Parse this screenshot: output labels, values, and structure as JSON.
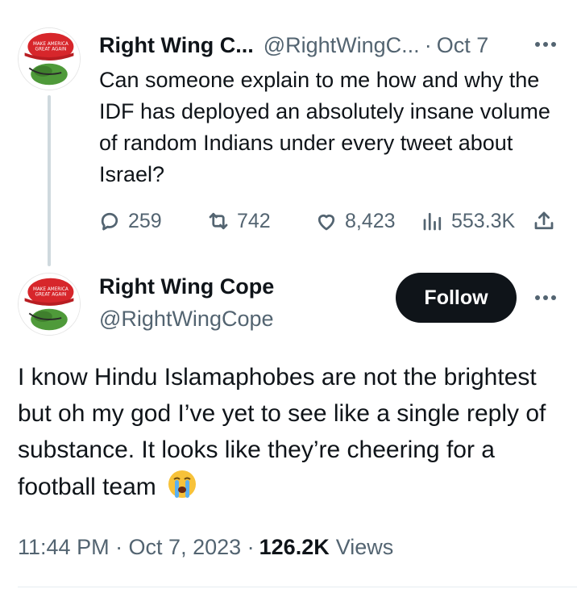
{
  "first_tweet": {
    "author_name": "Right Wing C...",
    "handle": "@RightWingC...",
    "separator": "·",
    "date": "Oct 7",
    "text": "Can someone explain to me how and why the IDF has deployed an absolutely insane volume of random Indians under every tweet about Israel?",
    "replies": "259",
    "reposts": "742",
    "likes": "8,423",
    "views": "553.3K",
    "icons": [
      "reply-icon",
      "repost-icon",
      "like-icon",
      "views-icon",
      "share-icon",
      "more-icon"
    ]
  },
  "second_tweet": {
    "author_name": "Right Wing Cope",
    "handle": "@RightWingCope",
    "follow_label": "Follow",
    "text": "I know Hindu Islamaphobes are not the brightest but oh my god I’ve yet to see like a single reply of substance. It looks like they’re cheering for a football team",
    "emoji": "crying-face-emoji",
    "timestamp": "11:44 PM · Oct 7, 2023 · ",
    "views_count": "126.2K",
    "views_label": "Views"
  },
  "colors": {
    "text_primary": "#0f1419",
    "text_secondary": "#536471",
    "thread_line": "#cfd9de",
    "follow_bg": "#0f1419",
    "avatar_hat": "#d7262b",
    "avatar_frog": "#4f9a3a"
  }
}
